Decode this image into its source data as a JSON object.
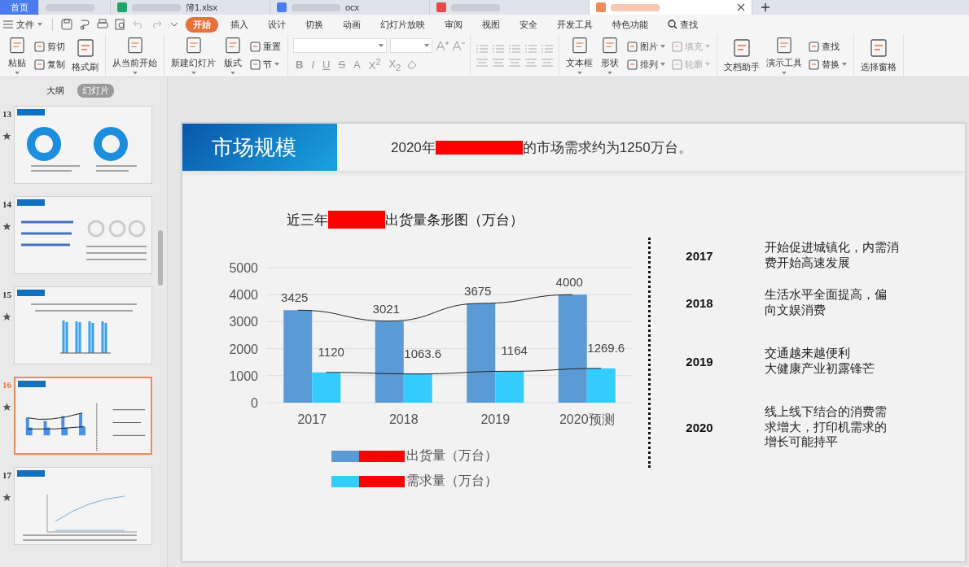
{
  "browser_tabs": [
    {
      "kind": "home",
      "label": "首页",
      "selected": false
    },
    {
      "kind": "blurred",
      "selected": false
    },
    {
      "kind": "sheet",
      "label": "簿1.xlsx",
      "selected": false
    },
    {
      "kind": "doc",
      "label": "ocx",
      "selected": false
    },
    {
      "kind": "pdf",
      "selected": false
    },
    {
      "kind": "presentation",
      "selected": true
    }
  ],
  "menu": {
    "file": "文件",
    "tabs": [
      {
        "label": "开始",
        "selected": true
      },
      {
        "label": "插入",
        "selected": false
      },
      {
        "label": "设计",
        "selected": false
      },
      {
        "label": "切换",
        "selected": false
      },
      {
        "label": "动画",
        "selected": false
      },
      {
        "label": "幻灯片放映",
        "selected": false
      },
      {
        "label": "审阅",
        "selected": false
      },
      {
        "label": "视图",
        "selected": false
      },
      {
        "label": "安全",
        "selected": false
      },
      {
        "label": "开发工具",
        "selected": false
      },
      {
        "label": "特色功能",
        "selected": false
      }
    ],
    "search": "查找"
  },
  "ribbon": [
    {
      "kind": "tools",
      "items": [
        {
          "label": "粘贴",
          "kind": "large",
          "dropdown": true,
          "disabled": false
        },
        {
          "label": "剪切",
          "kind": "small",
          "dropdown": false,
          "disabled": false
        },
        {
          "label": "复制",
          "kind": "small",
          "dropdown": false,
          "disabled": false
        },
        {
          "label": "格式刷",
          "kind": "large",
          "dropdown": false,
          "disabled": false
        }
      ]
    },
    {
      "kind": "tools",
      "items": [
        {
          "label": "从当前开始",
          "kind": "large",
          "dropdown": true,
          "disabled": false
        }
      ]
    },
    {
      "kind": "tools",
      "items": [
        {
          "label": "新建幻灯片",
          "kind": "large",
          "dropdown": true,
          "disabled": false
        },
        {
          "label": "版式",
          "kind": "large",
          "dropdown": true,
          "disabled": false
        },
        {
          "label": "重置",
          "kind": "small",
          "dropdown": false,
          "disabled": false
        },
        {
          "label": "节",
          "kind": "small",
          "dropdown": true,
          "disabled": false
        }
      ]
    },
    {
      "kind": "font",
      "formats": [
        "B",
        "I",
        "U",
        "S",
        "A",
        "X$^{2}$",
        "X$_{2}$"
      ]
    },
    {
      "kind": "paragraph"
    },
    {
      "kind": "tools",
      "items": [
        {
          "label": "文本框",
          "kind": "large",
          "dropdown": true,
          "disabled": false
        },
        {
          "label": "形状",
          "kind": "large",
          "dropdown": true,
          "disabled": false
        },
        {
          "label": "图片",
          "kind": "small",
          "dropdown": true,
          "disabled": false
        },
        {
          "label": "排列",
          "kind": "small",
          "dropdown": true,
          "disabled": false
        },
        {
          "label": "填充",
          "kind": "small",
          "dropdown": true,
          "disabled": true
        },
        {
          "label": "轮廓",
          "kind": "small",
          "dropdown": true,
          "disabled": true
        }
      ]
    },
    {
      "kind": "tools",
      "items": [
        {
          "label": "文档助手",
          "kind": "large",
          "dropdown": false,
          "disabled": false
        },
        {
          "label": "演示工具",
          "kind": "large",
          "dropdown": true,
          "disabled": false
        },
        {
          "label": "查找",
          "kind": "small",
          "dropdown": false,
          "disabled": false
        },
        {
          "label": "替换",
          "kind": "small",
          "dropdown": true,
          "disabled": false
        }
      ]
    },
    {
      "kind": "tools",
      "items": [
        {
          "label": "选择窗格",
          "kind": "large",
          "dropdown": false,
          "disabled": false
        }
      ]
    }
  ],
  "sidebar": {
    "views": [
      {
        "label": "大纲",
        "selected": false
      },
      {
        "label": "幻灯片",
        "selected": true
      }
    ],
    "slides": [
      {
        "number": "13",
        "kind": "donut",
        "selected": false
      },
      {
        "number": "14",
        "kind": "rings",
        "selected": false
      },
      {
        "number": "15",
        "kind": "bars",
        "selected": false
      },
      {
        "number": "16",
        "kind": "combo",
        "selected": true
      },
      {
        "number": "17",
        "kind": "line",
        "selected": false
      }
    ]
  },
  "slide": {
    "title": "市场规模",
    "subtitle": [
      "2020年",
      "的市场需求约为1250万台。"
    ],
    "chart_title": [
      "近三年",
      "出货量条形图（万台）"
    ],
    "chart_data": {
      "type": "bar",
      "categories": [
        "2017",
        "2018",
        "2019",
        "2020预测"
      ],
      "series": [
        {
          "name": "出货量（万台）",
          "color": "#5b9bd5",
          "values": [
            3425,
            3021,
            3675,
            4000
          ]
        },
        {
          "name": "需求量（万台）",
          "color": "#33ccff",
          "values": [
            1120,
            1063.6,
            1164,
            1269.6
          ]
        }
      ],
      "ylim": [
        0,
        5000
      ],
      "grid": true,
      "yticks": [
        0,
        1000,
        2000,
        3000,
        4000,
        5000
      ],
      "data_labels": true
    },
    "timeline": [
      {
        "year": "2017",
        "lines": [
          "开始促进城镇化，内需消",
          "费开始高速发展"
        ]
      },
      {
        "year": "2018",
        "lines": [
          "生活水平全面提高，偏",
          "向文娱消费"
        ]
      },
      {
        "year": "2019",
        "lines": [
          "交通越来越便利",
          "大健康产业初露锋芒"
        ]
      },
      {
        "year": "2020",
        "lines": [
          "线上线下结合的消费需",
          "求增大，打印机需求的",
          "增长可能持平"
        ]
      }
    ]
  }
}
